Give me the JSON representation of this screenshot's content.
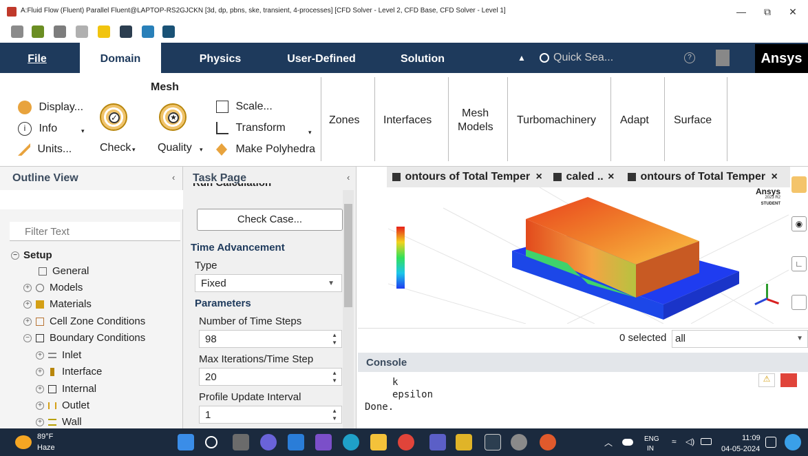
{
  "window": {
    "title": "A:Fluid Flow (Fluent) Parallel Fluent@LAPTOP-RS2GJCKN  [3d, dp, pbns, ske, transient, 4-processes] [CFD Solver - Level 2, CFD Base, CFD Solver - Level 1]",
    "minimize": "—",
    "restore": "⧉",
    "close": "✕"
  },
  "tabs": {
    "file": "File",
    "domain": "Domain",
    "physics": "Physics",
    "user_defined": "User-Defined",
    "solution": "Solution",
    "search_placeholder": "Quick Sea...",
    "brand": "Ansys"
  },
  "ribbon": {
    "mesh_group": "Mesh",
    "display": "Display...",
    "info": "Info",
    "units": "Units...",
    "check": "Check",
    "quality": "Quality",
    "scale": "Scale...",
    "transform": "Transform",
    "make_polyhedra": "Make Polyhedra",
    "zones": "Zones",
    "interfaces": "Interfaces",
    "mesh_models_1": "Mesh",
    "mesh_models_2": "Models",
    "turbomachinery": "Turbomachinery",
    "adapt": "Adapt",
    "surface": "Surface"
  },
  "outline": {
    "title": "Outline View",
    "filter_placeholder": "Filter Text",
    "setup": "Setup",
    "items": [
      "General",
      "Models",
      "Materials",
      "Cell Zone Conditions",
      "Boundary Conditions"
    ],
    "bc_items": [
      "Inlet",
      "Interface",
      "Internal",
      "Outlet",
      "Wall"
    ]
  },
  "task": {
    "title": "Task Page",
    "partial": "Run Calculation",
    "check_case": "Check Case...",
    "time_advancement": "Time Advancement",
    "type_label": "Type",
    "type_value": "Fixed",
    "parameters": "Parameters",
    "num_steps_label": "Number of Time Steps",
    "num_steps_value": "98",
    "max_iter_label": "Max Iterations/Time Step",
    "max_iter_value": "20",
    "profile_label": "Profile Update Interval",
    "profile_value": "1"
  },
  "graphics": {
    "tabs": [
      "ontours of Total Temper",
      "caled ..",
      "ontours of Total Temper"
    ],
    "close": "×",
    "logo": "Ansys",
    "logo_sub": "2023 R2",
    "logo_student": "STUDENT",
    "selected_text": "0 selected",
    "selected_value": "all"
  },
  "console": {
    "title": "Console",
    "lines": [
      "k",
      "epsilon",
      "Done."
    ]
  },
  "taskbar": {
    "temp": "89°F",
    "weather": "Haze",
    "lang1": "ENG",
    "lang2": "IN",
    "time": "11:09",
    "date": "04-05-2024"
  },
  "colors": {
    "ribbon_dark": "#1e3a5c",
    "accent_blue": "#1e3a5c",
    "taskbar": "#1b2a3e"
  }
}
